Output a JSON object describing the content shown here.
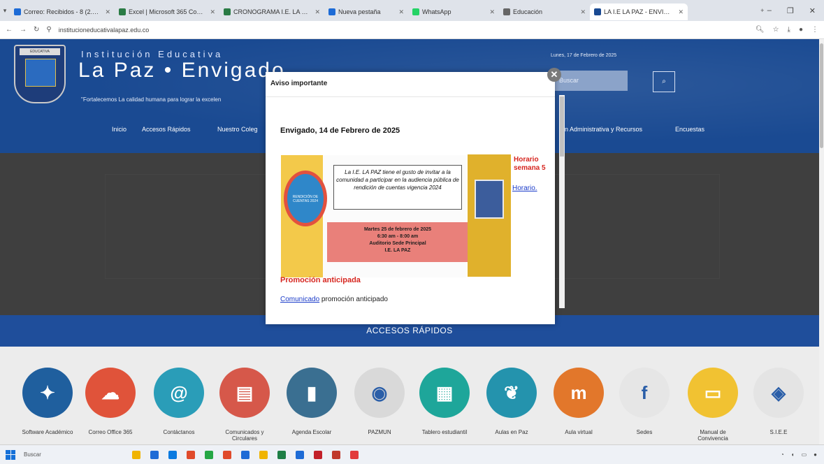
{
  "browser": {
    "tabs": [
      {
        "label": "Correo: Recibidos - 8 (2.492 ·",
        "color": "#1d6bd6",
        "active": false
      },
      {
        "label": "Excel | Microsoft 365 Copilot",
        "color": "#2a7b45",
        "active": false
      },
      {
        "label": "CRONOGRAMA I.E. LA PAZ 20",
        "color": "#2a7b45",
        "active": false
      },
      {
        "label": "Nueva pestaña",
        "color": "#1d6bd6",
        "active": false
      },
      {
        "label": "WhatsApp",
        "color": "#25d366",
        "active": false
      },
      {
        "label": "Educación",
        "color": "#666666",
        "active": false
      },
      {
        "label": "LA I.E LA PAZ - ENVIGADO",
        "color": "#1a4a92",
        "active": true
      }
    ],
    "new_tab": "+",
    "url": "institucioneducativalapaz.edu.co"
  },
  "site": {
    "kicker": "Institución Educativa",
    "title": "La Paz • Envigado",
    "slogan": "\"Fortalecemos La calidad humana para lograr la excelen",
    "date": "Lunes, 17 de Febrero de 2025",
    "search_placeholder": "Buscar",
    "nav": [
      "Inicio",
      "Accesos Rápidos",
      "Nuestro Coleg",
      "n Administrativa y Recursos",
      "Encuestas"
    ]
  },
  "modal": {
    "title": "Aviso importante",
    "heading": "Envigado, 14 de Febrero de 2025",
    "poster_left_text": "RENDICIÓN DE CUENTAS 2024",
    "poster_text": "La I.E. LA PAZ tiene el gusto de invitar a la comunidad a participar en la audiencia pública de rendición de cuentas vigencia 2024",
    "poster_date_lines": [
      "Martes 25 de febrero de 2025",
      "6:30 am - 8:00 am",
      "Auditorio Sede Principal",
      "I.E. LA PAZ"
    ],
    "horario_title_1": "Horario",
    "horario_title_2": "semana 5",
    "horario_link": "Horario.",
    "promo_title": "Promoción anticipada",
    "promo_link": "Comunicado",
    "promo_rest": " promoción anticipado"
  },
  "accesos": {
    "title": "ACCESOS RÁPIDOS",
    "items": [
      {
        "label": "Software Académico",
        "color": "#1f5f9e"
      },
      {
        "label": "Correo Office 365",
        "color": "#e0533a"
      },
      {
        "label": "Contáctanos",
        "color": "#2a9db8"
      },
      {
        "label": "Comunicados y Circulares",
        "color": "#d6584a"
      },
      {
        "label": "Agenda Escolar",
        "color": "#3a6f91"
      },
      {
        "label": "PAZMUN",
        "color": "#d9d9d9"
      },
      {
        "label": "Tablero estudiantil",
        "color": "#1ea69a"
      },
      {
        "label": "Aulas en Paz",
        "color": "#2493ad"
      },
      {
        "label": "Aula virtual",
        "color": "#e2772b"
      },
      {
        "label": "Sedes",
        "color": "#e6e6e6"
      },
      {
        "label": "Manual de Convivencia",
        "color": "#f1c232"
      },
      {
        "label": "S.I.E.E",
        "color": "#e4e4e4"
      }
    ]
  },
  "taskbar": {
    "search": "Buscar",
    "apps": [
      "#f0b400",
      "#1d6bd6",
      "#0a7ae0",
      "#e04a2b",
      "#25a745",
      "#e04a2b",
      "#1d6bd6",
      "#f0b400",
      "#1e7f46",
      "#1d6bd6",
      "#c2202a",
      "#c0392b",
      "#e23b3b"
    ]
  }
}
